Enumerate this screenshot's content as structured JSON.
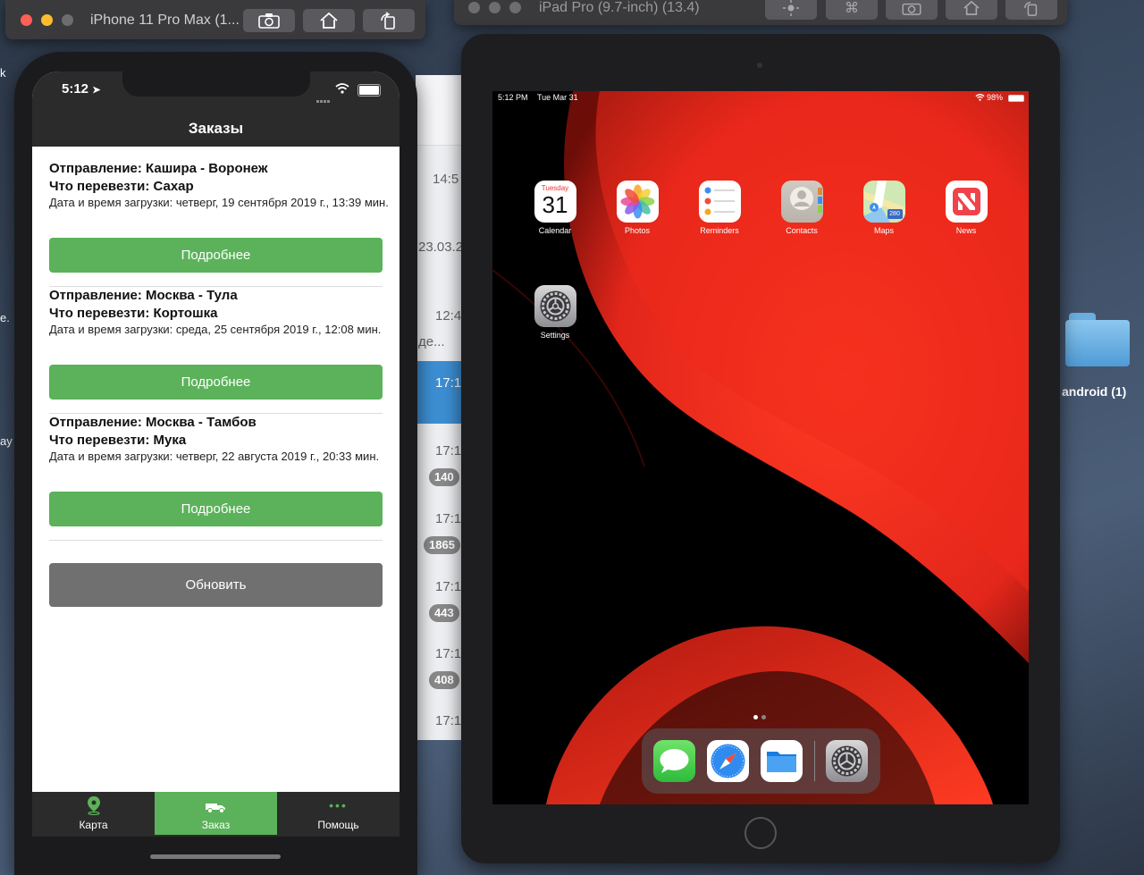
{
  "iphone_window": {
    "title": "iPhone 11 Pro Max (1...",
    "buttons": [
      "screenshot",
      "home",
      "rotate"
    ]
  },
  "ipad_window": {
    "title": "iPad Pro (9.7-inch) (13.4)",
    "buttons": [
      "brightness",
      "command",
      "screenshot",
      "home",
      "rotate"
    ]
  },
  "desktop": {
    "folder_label": "android (1)",
    "left_fragments": [
      "k",
      "e.",
      "ay"
    ]
  },
  "background_window": {
    "times": [
      "14:5",
      "12:4",
      "17:1",
      "17:1",
      "17:1",
      "17:1",
      "17:1",
      "17:1"
    ],
    "texts": [
      "23.03.2",
      "де..."
    ],
    "badges": [
      "140",
      "1865",
      "443",
      "408"
    ]
  },
  "iphone_app": {
    "status": {
      "time": "5:12"
    },
    "header_title": "Заказы",
    "orders": [
      {
        "route": "Отправление: Кашира - Воронеж",
        "cargo": "Что перевезти: Сахар",
        "datetime": "Дата и время загрузки: четверг, 19 сентября 2019 г., 13:39 мин.",
        "button": "Подробнее"
      },
      {
        "route": "Отправление: Москва - Тула",
        "cargo": "Что перевезти: Кортошка",
        "datetime": "Дата и время загрузки: среда, 25 сентября 2019 г., 12:08 мин.",
        "button": "Подробнее"
      },
      {
        "route": "Отправление: Москва - Тамбов",
        "cargo": "Что перевезти: Мука",
        "datetime": "Дата и время загрузки: четверг, 22 августа 2019 г., 20:33 мин.",
        "button": "Подробнее"
      }
    ],
    "refresh_button": "Обновить",
    "tabs": [
      {
        "label": "Карта",
        "icon": "map-pin-icon",
        "active": false
      },
      {
        "label": "Заказ",
        "icon": "truck-icon",
        "active": true
      },
      {
        "label": "Помощь",
        "icon": "more-icon",
        "active": false
      }
    ],
    "colors": {
      "green": "#5bb25a",
      "dark": "#2b2b2b",
      "gray_button": "#707070"
    }
  },
  "ipad": {
    "status": {
      "time": "5:12 PM",
      "date": "Tue Mar 31",
      "battery": "98%"
    },
    "calendar_icon": {
      "weekday": "Tuesday",
      "day": "31"
    },
    "maps_badge": "280",
    "apps": [
      "Calendar",
      "Photos",
      "Reminders",
      "Contacts",
      "Maps",
      "News",
      "Settings"
    ],
    "dock": [
      "messages-icon",
      "safari-icon",
      "files-icon",
      "settings-icon"
    ],
    "colors": {
      "wallpaper_red": "#e3261b"
    }
  }
}
